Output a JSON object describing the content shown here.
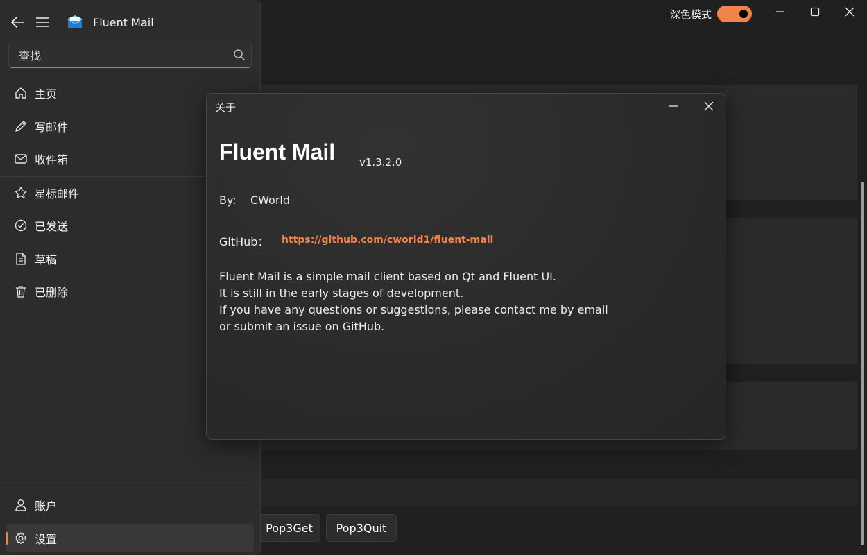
{
  "window": {
    "dark_mode_label": "深色模式",
    "dark_mode_on": true,
    "accent": "#f0844a"
  },
  "nav": {
    "app_title": "Fluent Mail",
    "search_placeholder": "查找",
    "items": [
      {
        "label": "主页",
        "icon": "home-icon"
      },
      {
        "label": "写邮件",
        "icon": "pencil-icon"
      },
      {
        "label": "收件箱",
        "icon": "mail-icon"
      },
      {
        "label": "星标邮件",
        "icon": "star-icon"
      },
      {
        "label": "已发送",
        "icon": "check-circle-icon"
      },
      {
        "label": "草稿",
        "icon": "document-icon"
      },
      {
        "label": "已删除",
        "icon": "trash-icon"
      }
    ],
    "footer": [
      {
        "label": "账户",
        "icon": "person-icon"
      },
      {
        "label": "设置",
        "icon": "gear-icon",
        "selected": true
      }
    ]
  },
  "background": {
    "buttons": [
      "Pop3Get",
      "Pop3Quit"
    ]
  },
  "dialog": {
    "title": "关于",
    "app_name": "Fluent Mail",
    "version": "v1.3.2.0",
    "by_label": "By:",
    "by_value": "CWorld",
    "github_label": "GitHub：",
    "github_url": "https://github.com/cworld1/fluent-mail",
    "description": [
      "Fluent Mail is a simple mail client based on Qt and Fluent UI.",
      "It is still in the early stages of development.",
      "If you have any questions or suggestions, please contact me by email",
      "or submit an issue on GitHub."
    ]
  }
}
